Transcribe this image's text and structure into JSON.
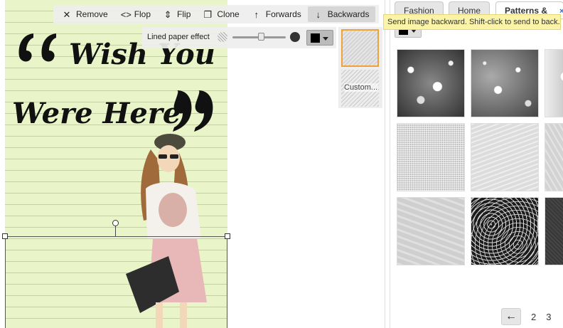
{
  "toolbar": {
    "remove_label": "Remove",
    "flop_label": "Flop",
    "flip_label": "Flip",
    "clone_label": "Clone",
    "forwards_label": "Forwards",
    "backwards_label": "Backwards"
  },
  "effect": {
    "label": "Lined paper effect",
    "custom_label": "Custom...",
    "color": "#000000"
  },
  "poster": {
    "line1": "Wish You",
    "line2": "Were Here",
    "background_color": "#e9f5c8"
  },
  "tabs": [
    {
      "label": "Fashion"
    },
    {
      "label": "Home"
    },
    {
      "label": "Patterns & ..."
    }
  ],
  "tab_close_label": "×",
  "tooltip": "Send image backward. Shift-click to send to back.",
  "pager": {
    "prev_icon": "arrow-left-icon",
    "pages": [
      "2",
      "3"
    ]
  },
  "patterns": [
    {
      "name": "bokeh-dark"
    },
    {
      "name": "bokeh-gray"
    },
    {
      "name": "bokeh-light"
    },
    {
      "name": "fine-grid"
    },
    {
      "name": "light-texture"
    },
    {
      "name": "light-texture-2"
    },
    {
      "name": "soft-texture"
    },
    {
      "name": "swirl-dark"
    },
    {
      "name": "dark-texture"
    }
  ],
  "colors": {
    "accent_selected": "#f0a23a",
    "tooltip_bg": "#fbf4a7"
  }
}
